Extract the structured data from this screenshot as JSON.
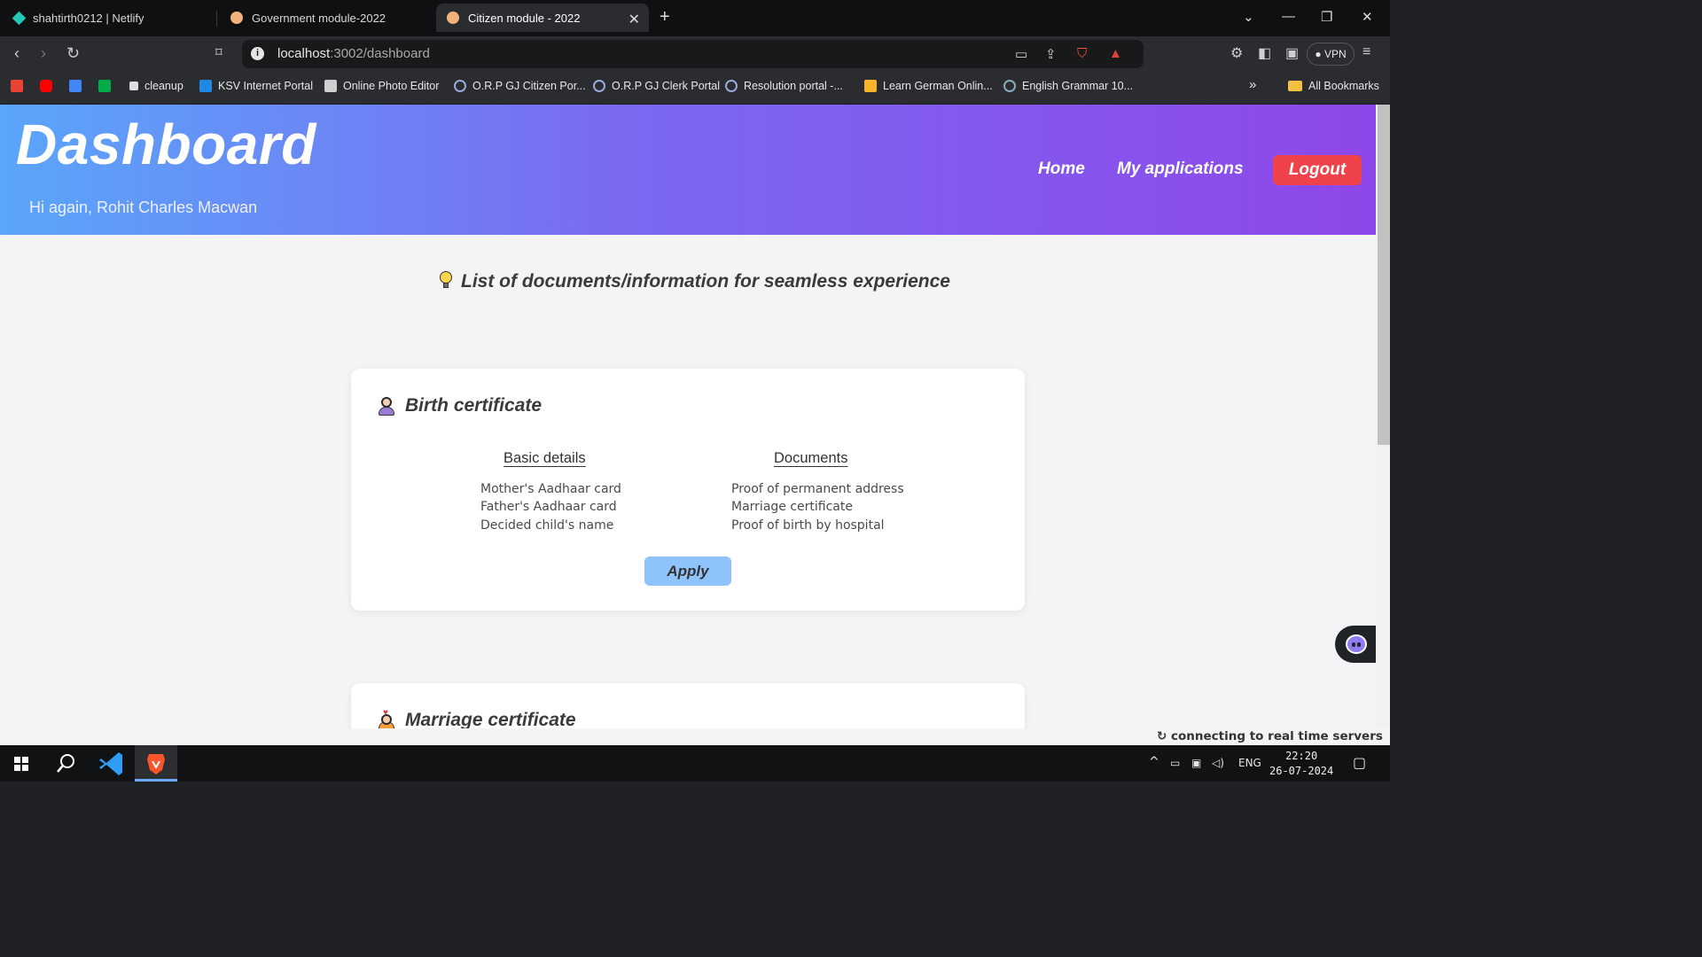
{
  "browser": {
    "tabs": [
      {
        "title": "shahtirth0212 | Netlify",
        "active": false
      },
      {
        "title": "Government module-2022",
        "active": false
      },
      {
        "title": "Citizen module - 2022",
        "active": true
      }
    ],
    "new_tab": "+",
    "url_host": "localhost",
    "url_path": ":3002/dashboard",
    "vpn_label": "VPN",
    "bookmarks": [
      {
        "label": "",
        "icon": "gmail-icon"
      },
      {
        "label": "",
        "icon": "youtube-icon"
      },
      {
        "label": "",
        "icon": "google-translate-icon"
      },
      {
        "label": "",
        "icon": "google-meet-icon"
      },
      {
        "label": "cleanup",
        "icon": "brush-icon"
      },
      {
        "label": "KSV Internet Portal",
        "icon": "ksv-icon"
      },
      {
        "label": "Online Photo Editor",
        "icon": "photo-editor-icon"
      },
      {
        "label": "O.R.P GJ Citizen Por...",
        "icon": "react-icon"
      },
      {
        "label": "O.R.P GJ Clerk Portal",
        "icon": "react-icon"
      },
      {
        "label": "Resolution portal -...",
        "icon": "react-icon"
      },
      {
        "label": "Learn German Onlin...",
        "icon": "dl-icon"
      },
      {
        "label": "English Grammar 10...",
        "icon": "power-icon"
      }
    ],
    "more_bookmarks": "»",
    "all_bookmarks": "All Bookmarks"
  },
  "header": {
    "title": "Dashboard",
    "greeting": "Hi again, Rohit Charles Macwan",
    "nav": {
      "home": "Home",
      "applications": "My applications",
      "logout": "Logout"
    }
  },
  "main": {
    "heading": "List of documents/information for seamless experience",
    "cards": [
      {
        "title": "Birth certificate",
        "basic_header": "Basic details",
        "basic_items": [
          "Mother's Aadhaar card",
          "Father's Aadhaar card",
          "Decided child's name"
        ],
        "docs_header": "Documents",
        "docs_items": [
          "Proof of permanent address",
          "Marriage certificate",
          "Proof of birth by hospital"
        ],
        "apply_label": "Apply"
      },
      {
        "title": "Marriage certificate"
      }
    ],
    "status_note": "connecting to real time servers"
  },
  "taskbar": {
    "tray_lang": "ENG",
    "time": "22:20",
    "date": "26-07-2024"
  },
  "colors": {
    "gradient_start": "#5aa6fb",
    "gradient_end": "#8e47ea",
    "logout_bg": "#f0424a",
    "apply_bg": "#8fc3fb"
  }
}
